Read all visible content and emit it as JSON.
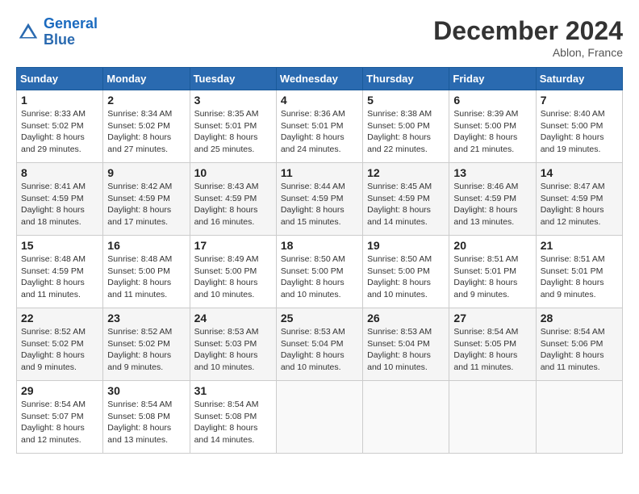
{
  "header": {
    "logo_line1": "General",
    "logo_line2": "Blue",
    "month_title": "December 2024",
    "location": "Ablon, France"
  },
  "days_of_week": [
    "Sunday",
    "Monday",
    "Tuesday",
    "Wednesday",
    "Thursday",
    "Friday",
    "Saturday"
  ],
  "weeks": [
    [
      {
        "day": "1",
        "sunrise": "8:33 AM",
        "sunset": "5:02 PM",
        "daylight": "8 hours and 29 minutes."
      },
      {
        "day": "2",
        "sunrise": "8:34 AM",
        "sunset": "5:02 PM",
        "daylight": "8 hours and 27 minutes."
      },
      {
        "day": "3",
        "sunrise": "8:35 AM",
        "sunset": "5:01 PM",
        "daylight": "8 hours and 25 minutes."
      },
      {
        "day": "4",
        "sunrise": "8:36 AM",
        "sunset": "5:01 PM",
        "daylight": "8 hours and 24 minutes."
      },
      {
        "day": "5",
        "sunrise": "8:38 AM",
        "sunset": "5:00 PM",
        "daylight": "8 hours and 22 minutes."
      },
      {
        "day": "6",
        "sunrise": "8:39 AM",
        "sunset": "5:00 PM",
        "daylight": "8 hours and 21 minutes."
      },
      {
        "day": "7",
        "sunrise": "8:40 AM",
        "sunset": "5:00 PM",
        "daylight": "8 hours and 19 minutes."
      }
    ],
    [
      {
        "day": "8",
        "sunrise": "8:41 AM",
        "sunset": "4:59 PM",
        "daylight": "8 hours and 18 minutes."
      },
      {
        "day": "9",
        "sunrise": "8:42 AM",
        "sunset": "4:59 PM",
        "daylight": "8 hours and 17 minutes."
      },
      {
        "day": "10",
        "sunrise": "8:43 AM",
        "sunset": "4:59 PM",
        "daylight": "8 hours and 16 minutes."
      },
      {
        "day": "11",
        "sunrise": "8:44 AM",
        "sunset": "4:59 PM",
        "daylight": "8 hours and 15 minutes."
      },
      {
        "day": "12",
        "sunrise": "8:45 AM",
        "sunset": "4:59 PM",
        "daylight": "8 hours and 14 minutes."
      },
      {
        "day": "13",
        "sunrise": "8:46 AM",
        "sunset": "4:59 PM",
        "daylight": "8 hours and 13 minutes."
      },
      {
        "day": "14",
        "sunrise": "8:47 AM",
        "sunset": "4:59 PM",
        "daylight": "8 hours and 12 minutes."
      }
    ],
    [
      {
        "day": "15",
        "sunrise": "8:48 AM",
        "sunset": "4:59 PM",
        "daylight": "8 hours and 11 minutes."
      },
      {
        "day": "16",
        "sunrise": "8:48 AM",
        "sunset": "5:00 PM",
        "daylight": "8 hours and 11 minutes."
      },
      {
        "day": "17",
        "sunrise": "8:49 AM",
        "sunset": "5:00 PM",
        "daylight": "8 hours and 10 minutes."
      },
      {
        "day": "18",
        "sunrise": "8:50 AM",
        "sunset": "5:00 PM",
        "daylight": "8 hours and 10 minutes."
      },
      {
        "day": "19",
        "sunrise": "8:50 AM",
        "sunset": "5:00 PM",
        "daylight": "8 hours and 10 minutes."
      },
      {
        "day": "20",
        "sunrise": "8:51 AM",
        "sunset": "5:01 PM",
        "daylight": "8 hours and 9 minutes."
      },
      {
        "day": "21",
        "sunrise": "8:51 AM",
        "sunset": "5:01 PM",
        "daylight": "8 hours and 9 minutes."
      }
    ],
    [
      {
        "day": "22",
        "sunrise": "8:52 AM",
        "sunset": "5:02 PM",
        "daylight": "8 hours and 9 minutes."
      },
      {
        "day": "23",
        "sunrise": "8:52 AM",
        "sunset": "5:02 PM",
        "daylight": "8 hours and 9 minutes."
      },
      {
        "day": "24",
        "sunrise": "8:53 AM",
        "sunset": "5:03 PM",
        "daylight": "8 hours and 10 minutes."
      },
      {
        "day": "25",
        "sunrise": "8:53 AM",
        "sunset": "5:04 PM",
        "daylight": "8 hours and 10 minutes."
      },
      {
        "day": "26",
        "sunrise": "8:53 AM",
        "sunset": "5:04 PM",
        "daylight": "8 hours and 10 minutes."
      },
      {
        "day": "27",
        "sunrise": "8:54 AM",
        "sunset": "5:05 PM",
        "daylight": "8 hours and 11 minutes."
      },
      {
        "day": "28",
        "sunrise": "8:54 AM",
        "sunset": "5:06 PM",
        "daylight": "8 hours and 11 minutes."
      }
    ],
    [
      {
        "day": "29",
        "sunrise": "8:54 AM",
        "sunset": "5:07 PM",
        "daylight": "8 hours and 12 minutes."
      },
      {
        "day": "30",
        "sunrise": "8:54 AM",
        "sunset": "5:08 PM",
        "daylight": "8 hours and 13 minutes."
      },
      {
        "day": "31",
        "sunrise": "8:54 AM",
        "sunset": "5:08 PM",
        "daylight": "8 hours and 14 minutes."
      },
      null,
      null,
      null,
      null
    ]
  ]
}
